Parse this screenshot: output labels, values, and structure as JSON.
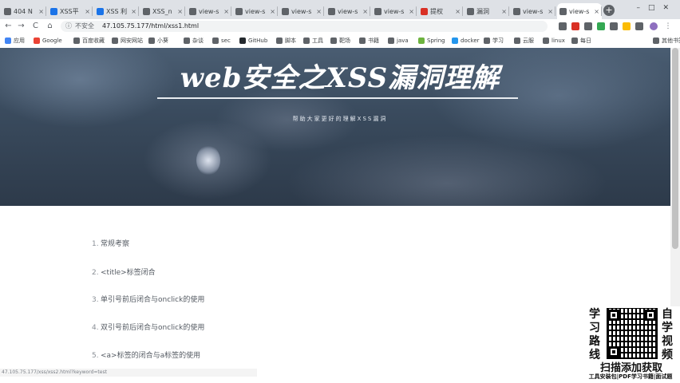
{
  "browser": {
    "tabs": [
      {
        "label": "404 N",
        "fav": "#5f6368"
      },
      {
        "label": "XSS平",
        "fav": "#1a73e8"
      },
      {
        "label": "XSS 利",
        "fav": "#1a73e8"
      },
      {
        "label": "XSS_n",
        "fav": "#5f6368"
      },
      {
        "label": "view-s",
        "fav": "#5f6368"
      },
      {
        "label": "view-s",
        "fav": "#5f6368"
      },
      {
        "label": "view-s",
        "fav": "#5f6368"
      },
      {
        "label": "view-s",
        "fav": "#5f6368"
      },
      {
        "label": "view-s",
        "fav": "#5f6368"
      },
      {
        "label": "提权",
        "fav": "#d93025"
      },
      {
        "label": "漏洞",
        "fav": "#5f6368"
      },
      {
        "label": "view-s",
        "fav": "#5f6368"
      },
      {
        "label": "view-s",
        "fav": "#5f6368"
      }
    ],
    "new_tab_glyph": "+",
    "window_controls": "–□✕",
    "nav": {
      "back": "←",
      "forward": "→",
      "reload": "C",
      "home": "⌂"
    },
    "address": {
      "security_label": "不安全",
      "url": "47.105.75.177/html/xss1.html"
    },
    "bookmarks": [
      {
        "label": "应用",
        "color": "#4285f4"
      },
      {
        "label": "Google",
        "color": "#ea4335"
      },
      {
        "label": "百度收藏",
        "color": "#5f6368"
      },
      {
        "label": "网安网站",
        "color": "#5f6368"
      },
      {
        "label": "小葵",
        "color": "#5f6368"
      },
      {
        "label": "杂谈",
        "color": "#5f6368"
      },
      {
        "label": "sec",
        "color": "#5f6368"
      },
      {
        "label": "GitHub",
        "color": "#24292e"
      },
      {
        "label": "脚本",
        "color": "#5f6368"
      },
      {
        "label": "工具",
        "color": "#5f6368"
      },
      {
        "label": "靶场",
        "color": "#5f6368"
      },
      {
        "label": "书籍",
        "color": "#5f6368"
      },
      {
        "label": "java",
        "color": "#5f6368"
      },
      {
        "label": "Spring",
        "color": "#6db33f"
      },
      {
        "label": "docker",
        "color": "#2496ed"
      },
      {
        "label": "学习",
        "color": "#5f6368"
      },
      {
        "label": "云服",
        "color": "#5f6368"
      },
      {
        "label": "linux",
        "color": "#5f6368"
      },
      {
        "label": "每日",
        "color": "#5f6368"
      },
      {
        "label": "其他书签",
        "color": "#5f6368"
      }
    ]
  },
  "hero": {
    "title": "web安全之XSS漏洞理解",
    "subtitle": "帮助大家更好的理解XSS漏洞"
  },
  "content": {
    "items": [
      {
        "num": "1.",
        "text": "常规考察"
      },
      {
        "num": "2.",
        "text": "<title>标签闭合"
      },
      {
        "num": "3.",
        "text": "单引号前后闭合与onclick的使用"
      },
      {
        "num": "4.",
        "text": "双引号前后闭合与onclick的使用"
      },
      {
        "num": "5.",
        "text": "<a>标签的闭合与a标签的使用"
      }
    ]
  },
  "status": {
    "text": "47.105.75.177/xss/xss2.html?keyword=test"
  },
  "promo": {
    "left_chars": [
      "学",
      "习",
      "路",
      "线"
    ],
    "right_chars": [
      "自",
      "学",
      "视",
      "频"
    ],
    "cta": "扫描添加获取",
    "footer": "工具安装包|PDF学习书籍|面试题"
  }
}
